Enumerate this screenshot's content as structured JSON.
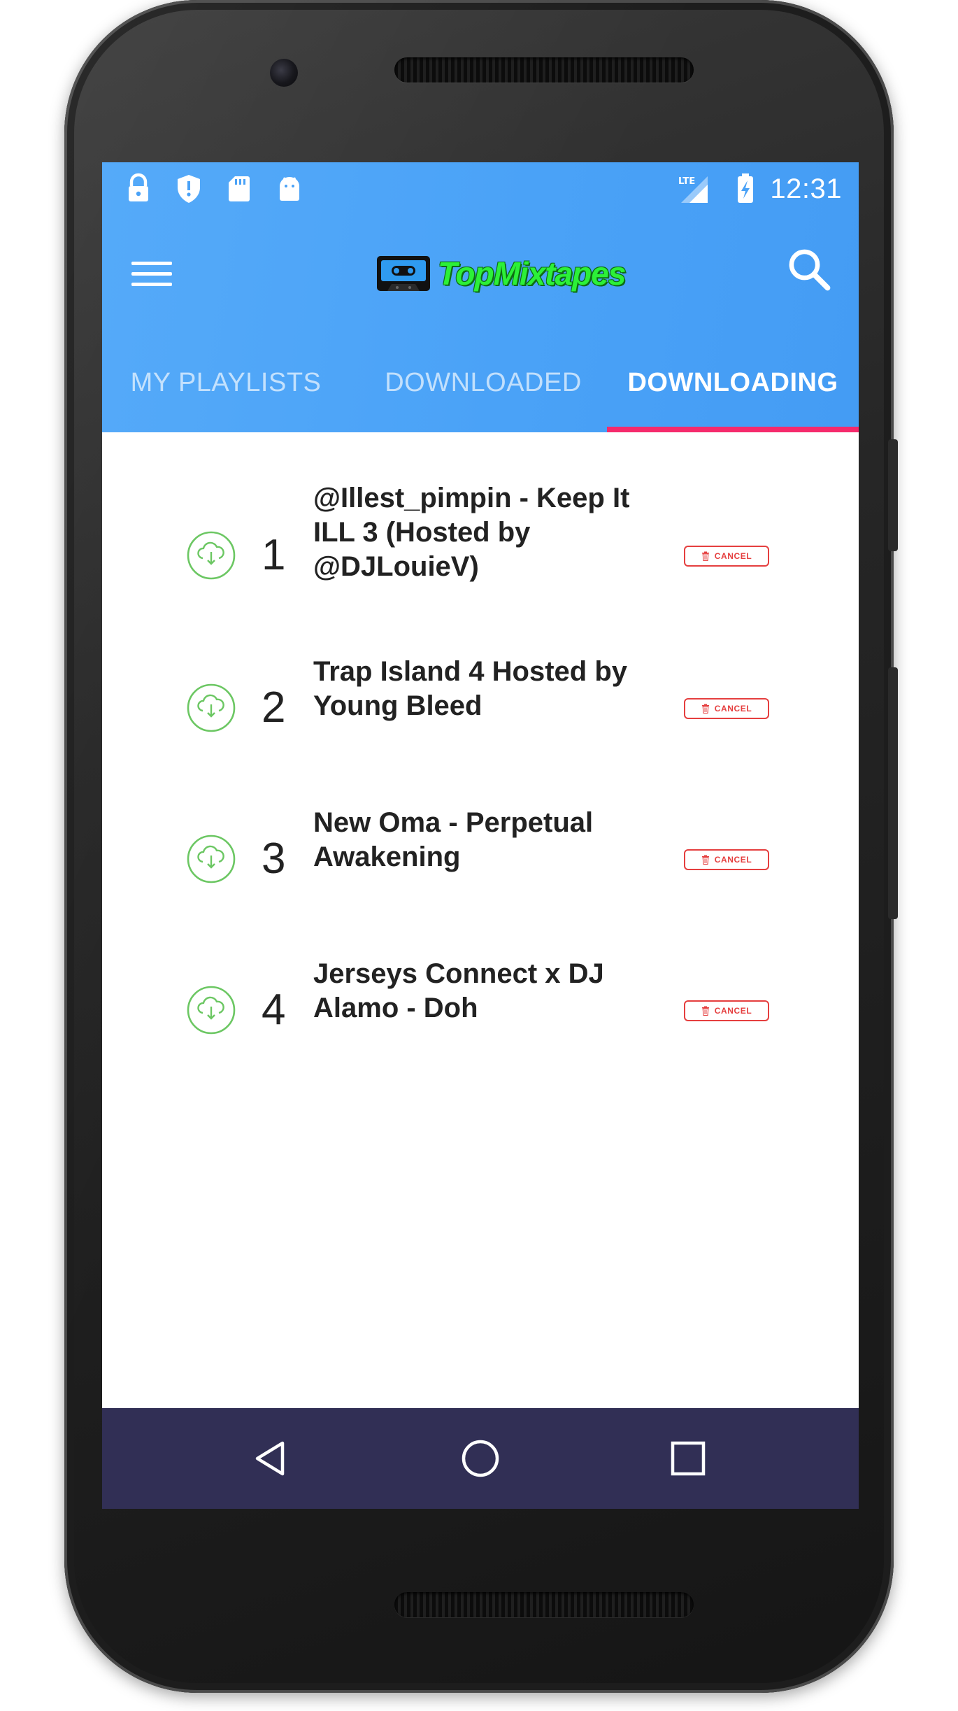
{
  "status_bar": {
    "time": "12:31",
    "network": "LTE",
    "left_icons": [
      "lock-icon",
      "shield-alert-icon",
      "sd-card-icon",
      "android-icon"
    ]
  },
  "toolbar": {
    "logo_text": "TopMixtapes",
    "menu_icon": "menu-icon",
    "search_icon": "search-icon"
  },
  "tabs": [
    {
      "label": "MY PLAYLISTS",
      "active": false
    },
    {
      "label": "DOWNLOADED",
      "active": false
    },
    {
      "label": "DOWNLOADING",
      "active": true
    }
  ],
  "downloads": [
    {
      "number": "1",
      "title": "@Illest_pimpin - Keep It ILL 3 (Hosted by @DJLouieV)",
      "action": "CANCEL"
    },
    {
      "number": "2",
      "title": "Trap Island 4 Hosted by Young Bleed",
      "action": "CANCEL"
    },
    {
      "number": "3",
      "title": "New Oma - Perpetual Awakening",
      "action": "CANCEL"
    },
    {
      "number": "4",
      "title": "Jerseys Connect x DJ Alamo - Doh",
      "action": "CANCEL"
    }
  ],
  "nav_bar": [
    "back-icon",
    "home-icon",
    "recents-icon"
  ],
  "colors": {
    "app_bar": "#4aa2f7",
    "tab_indicator": "#f52a6c",
    "download_icon": "#6cc763",
    "cancel": "#e53f3f",
    "nav_bar": "#312f55",
    "logo": "#2cf038"
  }
}
